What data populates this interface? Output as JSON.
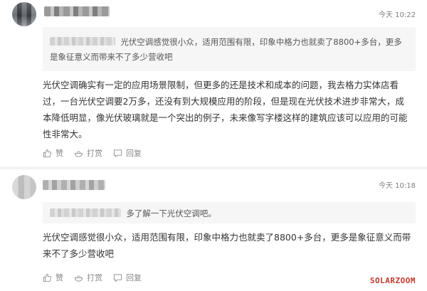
{
  "comments": [
    {
      "time": "今天 10:22",
      "quote_text": "光伏空调感觉很小众，适用范围有限，印象中格力也就卖了8800+多台，更多是象征意义而带来不了多少营收吧",
      "text": "光伏空调确实有一定的应用场景限制，但更多的还是技术和成本的问题，我去格力实体店看过，一台光伏空调要2万多，还没有到大规模应用的阶段，但是现在光伏技术进步非常大，成本降低明显，像光伏玻璃就是一个突出的例子，未来像写字楼这样的建筑应该可以应用的可能性非常大。",
      "actions": {
        "like": "赞",
        "tip": "打赏",
        "reply": "回复"
      }
    },
    {
      "time": "今天 10:18",
      "quote_text": "多了解一下光伏空调吧。",
      "text": "光伏空调感觉很小众，适用范围有限，印象中格力也就卖了8800+多台，更多是象征意义而带来不了多少营收吧",
      "actions": {
        "like": "赞",
        "tip": "打赏",
        "reply": "回复"
      }
    }
  ],
  "watermark": "SOLARZOOM"
}
